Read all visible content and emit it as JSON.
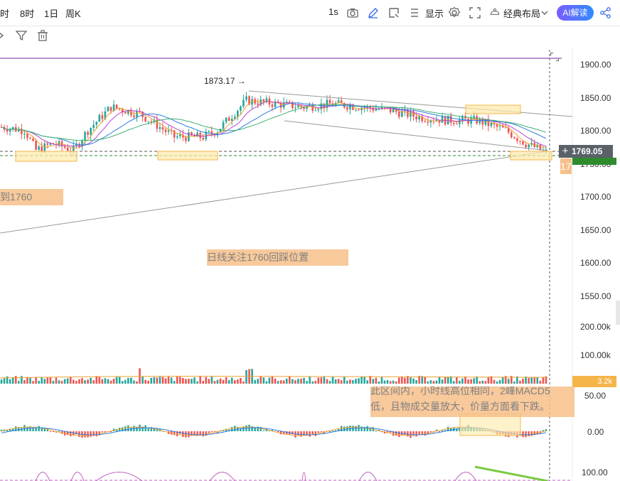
{
  "toolbar": {
    "timeframes": [
      "时",
      "8时",
      "1日",
      "周K"
    ],
    "interval": "1s",
    "display_label": "显示",
    "layout_label": "经典布局",
    "ai_label": "AI解读"
  },
  "icons": [
    "camera-icon",
    "pencil-icon",
    "rect-select-icon",
    "list-icon",
    "settings-icon",
    "fullscreen-icon",
    "layout-icon",
    "share-icon",
    "filter-icon",
    "trash-icon",
    "expand-icon"
  ],
  "colors": {
    "up": "#26a69a",
    "down": "#ef5350",
    "highlight_box": "#f5b54a",
    "note_bg": "#f7c08a",
    "price_tag": "#5b6169",
    "volume_tag": "#f5b54a",
    "purple_line": "#7b1fa2"
  },
  "price_axis": {
    "labels": [
      "1900.00",
      "1850.00",
      "1800.00",
      "1750.00",
      "1700.00",
      "1650.00",
      "1600.00",
      "1550.00"
    ],
    "current_price": "1769.05",
    "peak_label": "1873.17 →",
    "hidden_tag": "17"
  },
  "volume_axis": {
    "labels": [
      "200.00k",
      "100.00k"
    ],
    "current": "3.2k"
  },
  "macd_axis": {
    "labels": [
      "50.00",
      "0.00"
    ]
  },
  "rsi_axis": {
    "labels": [
      "100.00"
    ]
  },
  "notes": {
    "left": "到1760",
    "daily": "日线关注1760回踩位置",
    "commentary_line1": "此区间内，小时线高位相同，2峰MACD5",
    "commentary_line2": "低，且物成交量放大，价量方面看下跌。"
  }
}
